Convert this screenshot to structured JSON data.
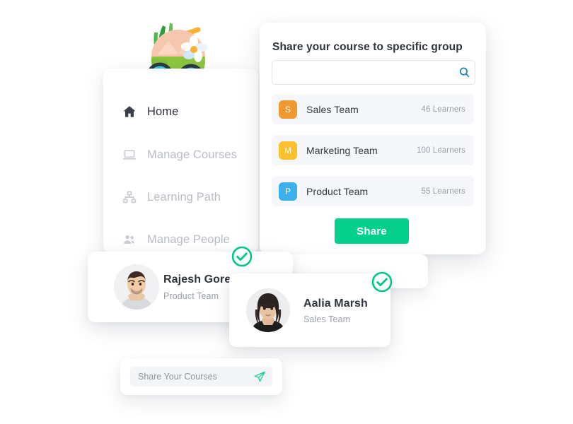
{
  "illustration": {
    "name": "coconut-drink-illustration",
    "colors": {
      "coconut_green": "#8cc63f",
      "coconut_flesh": "#f7c6ae",
      "straw_yellow": "#f9b233",
      "leaf_green": "#3fa535",
      "sunglass_lens": "#3ec6e0",
      "flower_white": "#ffffff",
      "flower_center": "#f9b233"
    }
  },
  "sidebar": {
    "items": [
      {
        "label": "Home",
        "icon": "home-icon",
        "active": true
      },
      {
        "label": "Manage Courses",
        "icon": "laptop-icon",
        "active": false
      },
      {
        "label": "Learning Path",
        "icon": "sitemap-icon",
        "active": false
      },
      {
        "label": "Manage People",
        "icon": "people-icon",
        "active": false
      }
    ]
  },
  "share_panel": {
    "title": "Share your course to specific group",
    "search": {
      "value": "",
      "placeholder": "",
      "icon": "search-icon",
      "icon_color": "#1d7fc3"
    },
    "teams": [
      {
        "initial": "S",
        "name": "Sales Team",
        "count": "46 Learners",
        "color": "#f0992e"
      },
      {
        "initial": "M",
        "name": "Marketing Team",
        "count": "100 Learners",
        "color": "#fcc02e"
      },
      {
        "initial": "P",
        "name": "Product Team",
        "count": "55 Learners",
        "color": "#3bb0ef"
      }
    ],
    "share_button": {
      "label": "Share",
      "color": "#04cf8b"
    }
  },
  "people": [
    {
      "name": "Rajesh Gore",
      "team": "Product Team",
      "selected": true,
      "avatar": "male-portrait"
    },
    {
      "name": "Aalia Marsh",
      "team": "Sales Team",
      "selected": true,
      "avatar": "female-portrait"
    }
  ],
  "check_badge": {
    "icon": "check-circle-icon",
    "color": "#00c881"
  },
  "share_bar": {
    "input": {
      "value": "",
      "placeholder": "Share Your Courses"
    },
    "send": {
      "icon": "send-icon",
      "color": "#19cf96"
    }
  }
}
